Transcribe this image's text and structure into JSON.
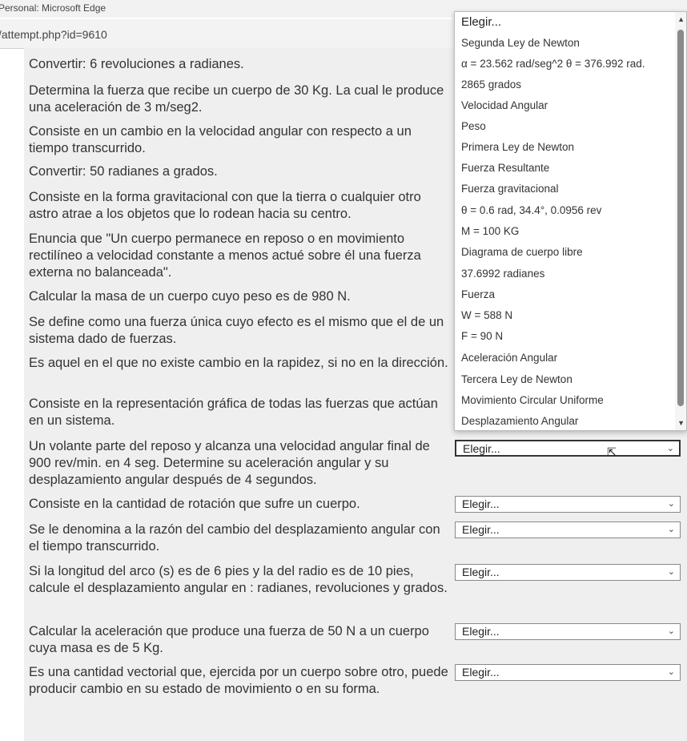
{
  "window": {
    "title": "Personal: Microsoft Edge",
    "url": "/attempt.php?id=9610"
  },
  "questions": [
    "Convertir: 6 revoluciones a radianes.",
    "Determina la fuerza que recibe un cuerpo de 30 Kg. La cual le produce una aceleración de 3 m/seg2.",
    "Consiste en un cambio en la velocidad angular con respecto a un tiempo transcurrido.",
    "Convertir: 50 radianes a grados.",
    "Consiste en la forma gravitacional con que la tierra o cualquier otro astro atrae a los objetos que lo rodean hacia su centro.",
    "Enuncia que \"Un cuerpo permanece en reposo o en movimiento rectilíneo a velocidad constante a menos actué sobre él una fuerza externa no balanceada\".",
    "Calcular la masa de un cuerpo cuyo peso es de 980 N.",
    "Se define como una fuerza única cuyo efecto es el mismo que el de un sistema dado de fuerzas.",
    "Es aquel en el que no existe cambio en la rapidez, si no en la dirección.",
    "Consiste en la representación gráfica de todas las fuerzas que actúan en un sistema.",
    "Un volante parte del reposo y alcanza una velocidad angular final de 900 rev/min. en 4 seg. Determine su aceleración angular y su desplazamiento angular después de 4 segundos.",
    "Consiste en la cantidad de rotación que sufre un cuerpo.",
    "Se le denomina a la razón del cambio del desplazamiento angular con el tiempo transcurrido.",
    "Si la longitud del arco (s) es de 6 pies y la del radio es de 10 pies, calcule el desplazamiento angular en : radianes, revoluciones y grados.",
    "Calcular la aceleración que produce una fuerza de 50 N a un cuerpo cuya masa es de 5 Kg.",
    "Es una cantidad vectorial que, ejercida por un cuerpo sobre otro, puede producir cambio en su estado de movimiento o en su forma."
  ],
  "select_placeholder": "Elegir...",
  "dropdown_options": [
    "Elegir...",
    "Segunda Ley de Newton",
    "α = 23.562 rad/seg^2 θ = 376.992 rad.",
    "2865 grados",
    "Velocidad Angular",
    "Peso",
    "Primera Ley de Newton",
    "Fuerza Resultante",
    "Fuerza gravitacional",
    "θ = 0.6 rad, 34.4°, 0.0956 rev",
    "M = 100 KG",
    "Diagrama de cuerpo libre",
    "37.6992 radianes",
    "Fuerza",
    "W = 588 N",
    "F = 90 N",
    "Aceleración Angular",
    "Tercera Ley de Newton",
    "Movimiento Circular Uniforme",
    "Desplazamiento Angular"
  ],
  "icons": {
    "chevron": "chevron-down-icon",
    "cursor": "mouse-pointer-icon"
  }
}
